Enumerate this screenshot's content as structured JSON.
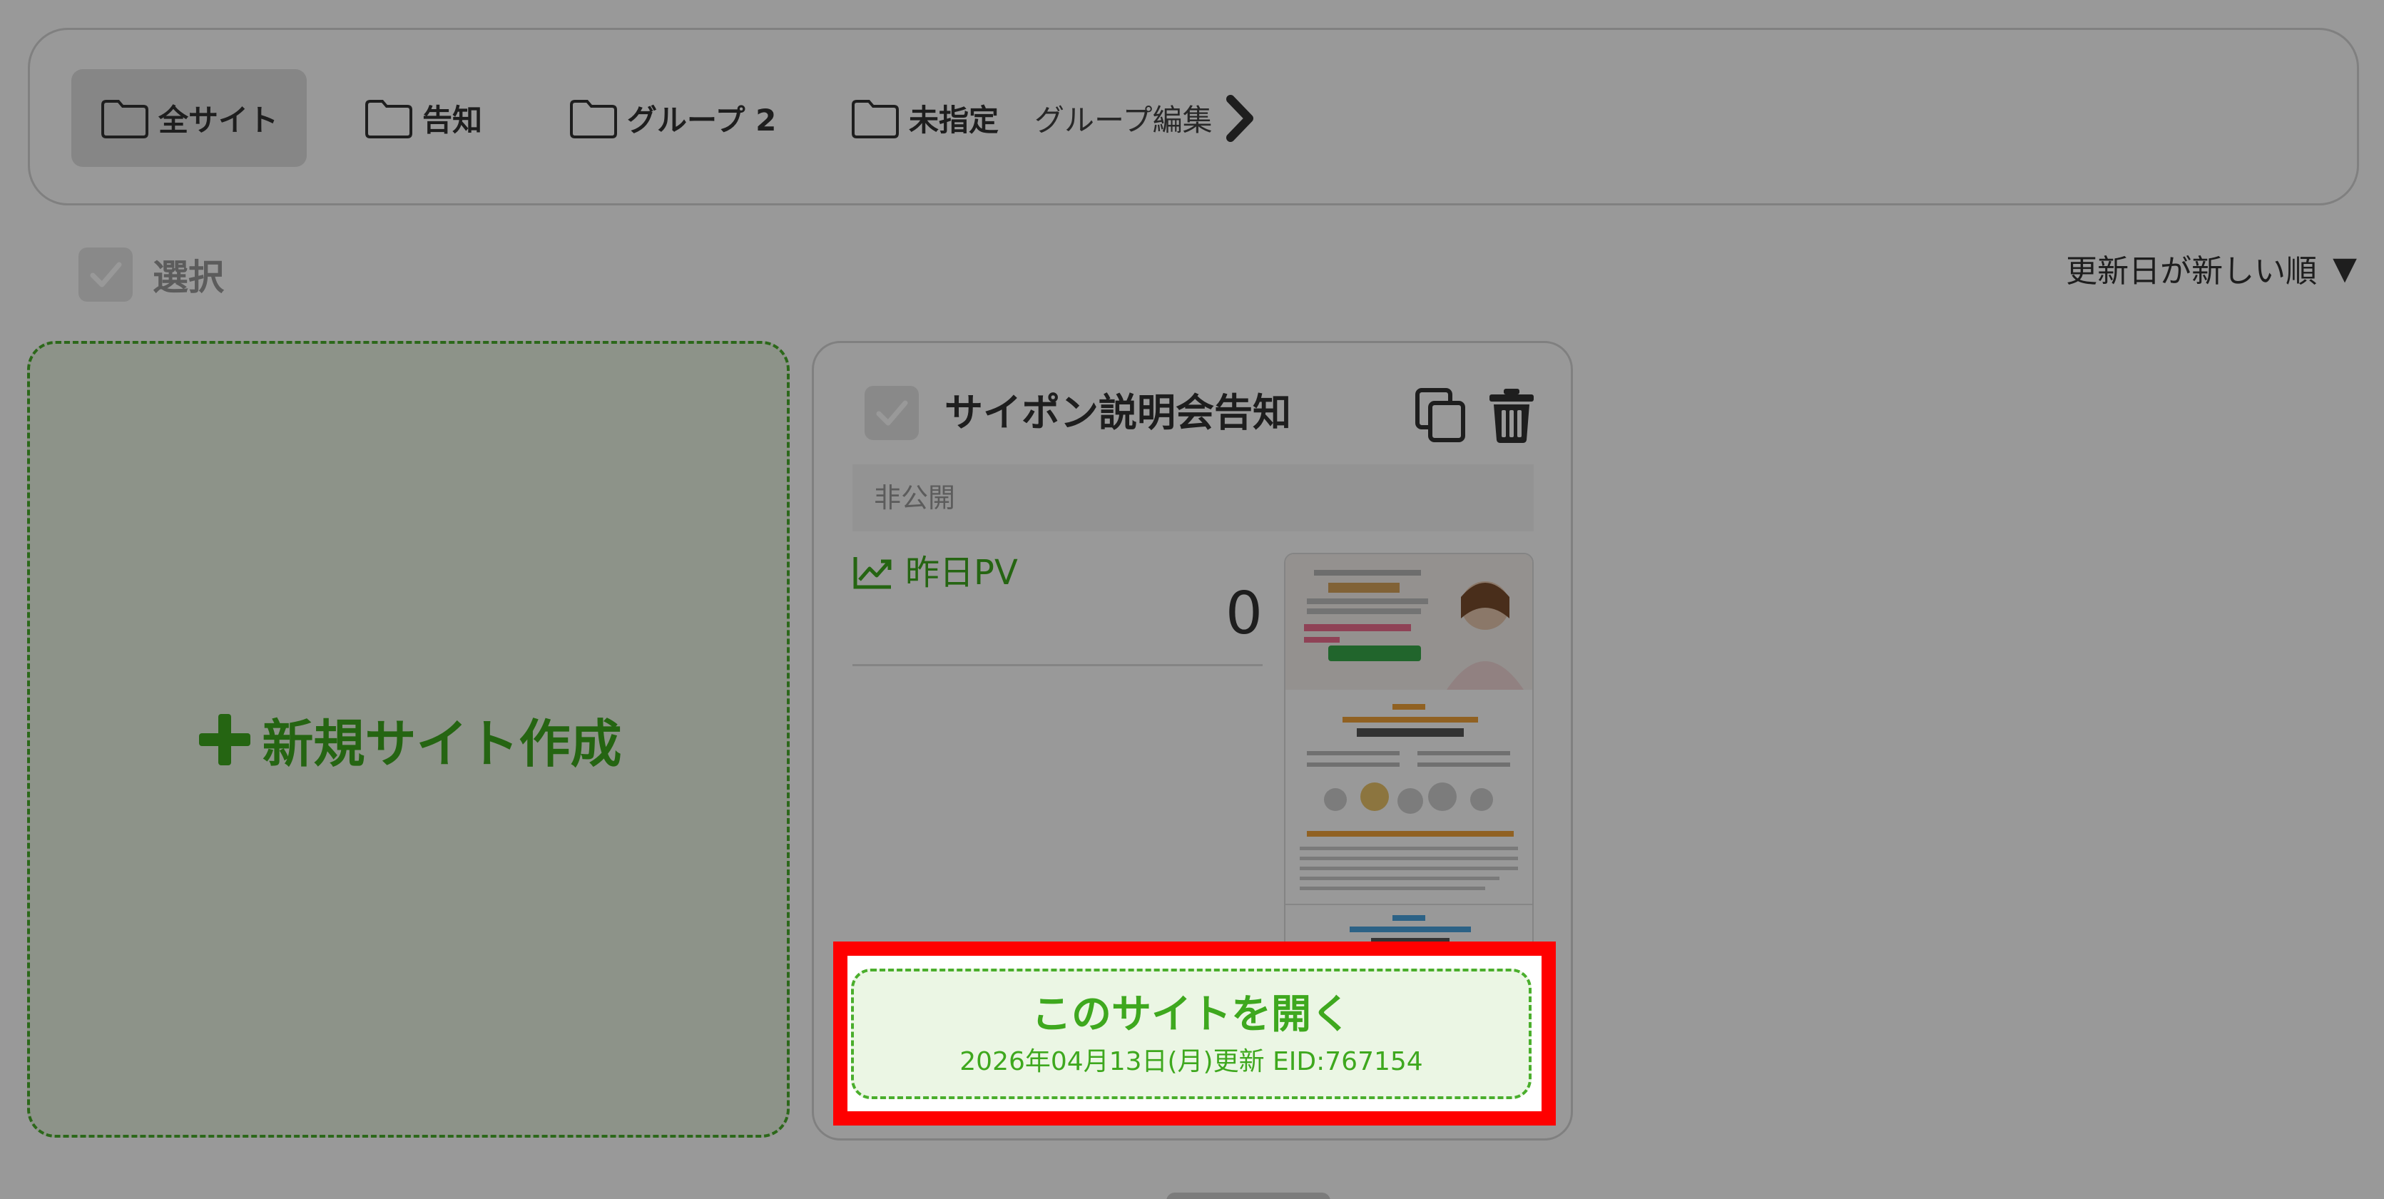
{
  "group_tabs": [
    {
      "label": "全サイト",
      "active": true
    },
    {
      "label": "告知",
      "active": false
    },
    {
      "label": "グループ 2",
      "active": false
    },
    {
      "label": "未指定",
      "active": false
    }
  ],
  "group_edit_label": "グループ編集",
  "select_label": "選択",
  "sort_label": "更新日が新しい順",
  "sort_arrow": "▼",
  "new_site_label": "新規サイト作成",
  "site_card": {
    "title": "サイポン説明会告知",
    "status": "非公開",
    "pv_label": "昨日PV",
    "pv_value": "0",
    "open_label": "このサイトを開く",
    "updated_meta": "2026年04月13日(月)更新 EID:767154"
  },
  "colors": {
    "accent_green": "#3ea81e",
    "highlight_red": "#ff0000",
    "green_bg": "#ebf6e4"
  },
  "icons": [
    "folder-icon",
    "chevron-right-icon",
    "check-icon",
    "plus-icon",
    "copy-icon",
    "trash-icon",
    "chart-line-icon"
  ]
}
